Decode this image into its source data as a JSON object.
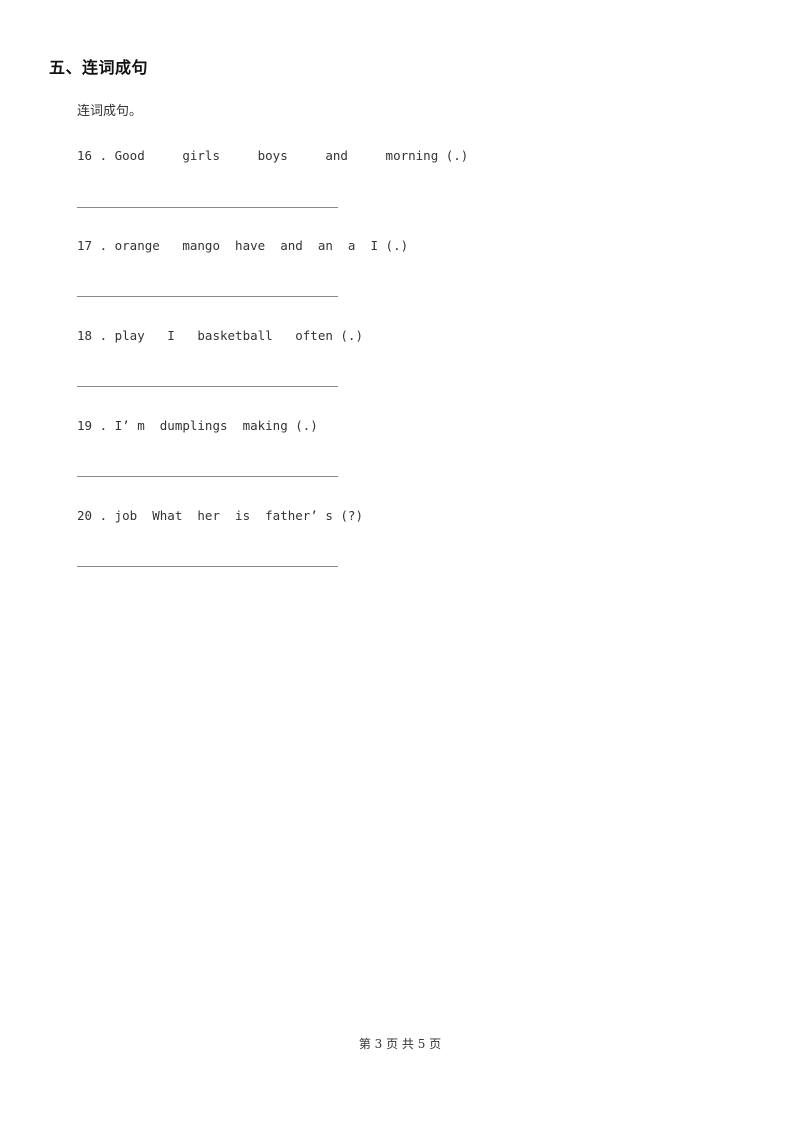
{
  "section": {
    "title": "五、连词成句",
    "instruction": "连词成句。"
  },
  "questions": [
    {
      "number": "16",
      "text": "16 . Good     girls     boys     and     morning (.)"
    },
    {
      "number": "17",
      "text": "17 . orange   mango  have  and  an  a  I (.)"
    },
    {
      "number": "18",
      "text": "18 . play   I   basketball   often (.)"
    },
    {
      "number": "19",
      "text": "19 . I’ m  dumplings  making (.)"
    },
    {
      "number": "20",
      "text": "20 . job  What  her  is  father’ s (?)"
    }
  ],
  "footer": {
    "page_label": "第 3 页 共 5 页"
  }
}
